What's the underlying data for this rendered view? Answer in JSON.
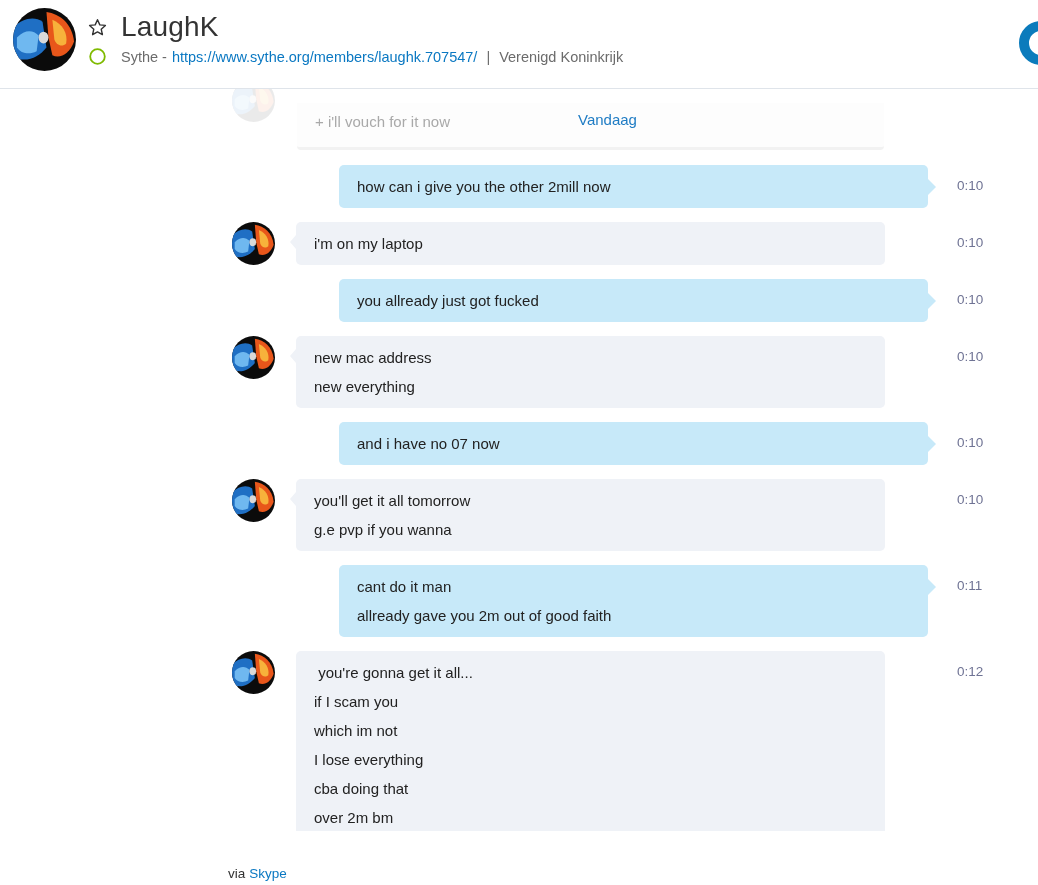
{
  "header": {
    "name": "LaughK",
    "favorite": false,
    "online": true,
    "source": "Sythe -",
    "url": "https://www.sythe.org/members/laughk.707547/",
    "separator": "|",
    "location": "Verenigd Koninkrijk"
  },
  "previous_message": {
    "text": "+ i'll vouch for it now"
  },
  "date_divider": "Vandaag",
  "messages": [
    {
      "kind": "outgoing",
      "lines": [
        "how can i give you the other 2mill now"
      ],
      "time": "0:10"
    },
    {
      "kind": "incoming",
      "lines": [
        "i'm on my laptop"
      ],
      "time": "0:10"
    },
    {
      "kind": "outgoing",
      "lines": [
        "you allready just got fucked"
      ],
      "time": "0:10"
    },
    {
      "kind": "incoming",
      "lines": [
        "new mac address",
        "new everything"
      ],
      "time": "0:10"
    },
    {
      "kind": "outgoing",
      "lines": [
        "and i have no 07 now"
      ],
      "time": "0:10"
    },
    {
      "kind": "incoming",
      "lines": [
        "you'll get it all tomorrow",
        "g.e pvp if you wanna"
      ],
      "time": "0:10"
    },
    {
      "kind": "outgoing",
      "lines": [
        "cant do it man",
        "allready gave you 2m out of good faith"
      ],
      "time": "0:11"
    },
    {
      "kind": "incoming",
      "lines": [
        " you're gonna get it all...",
        "if I scam you",
        "which im not",
        "I lose everything",
        "cba doing that",
        "over 2m bm"
      ],
      "time": "0:12"
    }
  ],
  "footer": {
    "prefix": "via",
    "link": "Skype"
  }
}
